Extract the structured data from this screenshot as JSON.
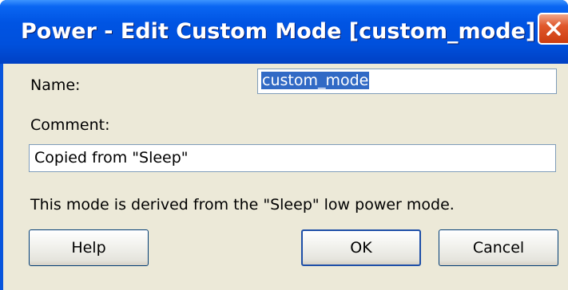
{
  "window": {
    "title": "Power - Edit Custom Mode [custom_mode]"
  },
  "form": {
    "name_label": "Name:",
    "name_value": "custom_mode",
    "comment_label": "Comment:",
    "comment_value": "Copied from \"Sleep\"",
    "info_text": "This mode is derived from the \"Sleep\" low power mode."
  },
  "buttons": {
    "help": "Help",
    "ok": "OK",
    "cancel": "Cancel"
  },
  "icons": {
    "close": "close-icon"
  },
  "colors": {
    "titlebar": "#0054e3",
    "client_bg": "#ece9d8",
    "selection": "#316ac5",
    "close_button": "#e0582c"
  }
}
